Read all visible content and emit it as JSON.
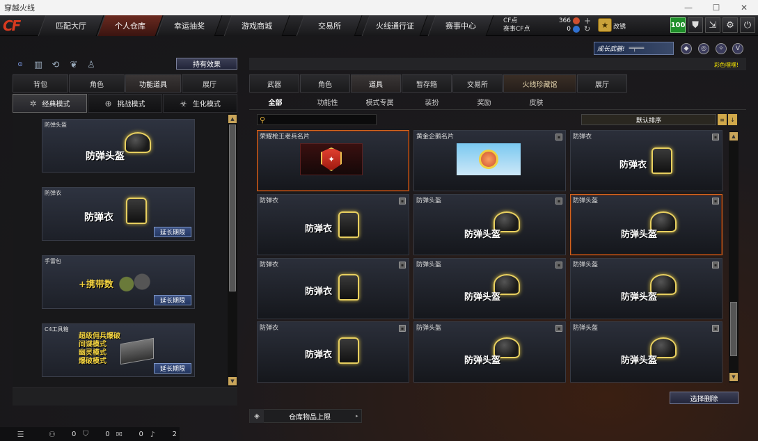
{
  "window": {
    "title": "穿越火线"
  },
  "nav": {
    "logo": "CF",
    "tabs": [
      {
        "label": "匹配大厅"
      },
      {
        "label": "个人仓库"
      },
      {
        "label": "幸运抽奖"
      },
      {
        "label": "游戏商城"
      },
      {
        "label": "交易所"
      },
      {
        "label": "火线通行证"
      },
      {
        "label": "赛事中心"
      }
    ],
    "active_tab": "个人仓库"
  },
  "points": {
    "cf_label": "CF点",
    "event_label": "赛事CF点",
    "cf_value": "366",
    "event_value": "0"
  },
  "user": {
    "rank_name": "改锈",
    "level": "100"
  },
  "banner": {
    "text": "成长武器!"
  },
  "yellow_note": "彩色嘿嘿!",
  "left": {
    "hold_effect_button": "持有效果",
    "tabs": [
      {
        "label": "背包"
      },
      {
        "label": "角色"
      },
      {
        "label": "功能道具"
      },
      {
        "label": "展厅"
      }
    ],
    "modes": [
      {
        "label": "经典模式"
      },
      {
        "label": "挑战模式"
      },
      {
        "label": "生化模式"
      }
    ],
    "items": [
      {
        "name": "防弹头盔",
        "big": "防弹头盔",
        "ext": ""
      },
      {
        "name": "防弹衣",
        "big": "防弹衣",
        "ext": "延长期限"
      },
      {
        "name": "手雷包",
        "big": "+携带数",
        "ext": "延长期限"
      },
      {
        "name": "C4工具箱",
        "lines": [
          "超级佣兵爆破",
          "间谍模式",
          "幽灵模式",
          "爆破模式"
        ],
        "ext": "延长期限"
      }
    ]
  },
  "right": {
    "tabs": [
      {
        "label": "武器"
      },
      {
        "label": "角色"
      },
      {
        "label": "道具"
      },
      {
        "label": "暂存箱"
      },
      {
        "label": "交易所"
      },
      {
        "label": "火线珍藏馆"
      },
      {
        "label": "展厅"
      }
    ],
    "subtabs": [
      {
        "label": "全部"
      },
      {
        "label": "功能性"
      },
      {
        "label": "模式专属"
      },
      {
        "label": "装扮"
      },
      {
        "label": "奖励"
      },
      {
        "label": "皮肤"
      }
    ],
    "search": {
      "placeholder": ""
    },
    "sort_label": "默认排序",
    "items": [
      {
        "name": "荣耀枪王老兵名片",
        "big": ""
      },
      {
        "name": "黄金企鹅名片",
        "big": ""
      },
      {
        "name": "防弹衣",
        "big": "防弹衣"
      },
      {
        "name": "防弹衣",
        "big": "防弹衣"
      },
      {
        "name": "防弹头盔",
        "big": "防弹头盔"
      },
      {
        "name": "防弹头盔",
        "big": "防弹头盔"
      },
      {
        "name": "防弹衣",
        "big": "防弹衣"
      },
      {
        "name": "防弹头盔",
        "big": "防弹头盔"
      },
      {
        "name": "防弹头盔",
        "big": "防弹头盔"
      },
      {
        "name": "防弹衣",
        "big": "防弹衣"
      },
      {
        "name": "防弹头盔",
        "big": "防弹头盔"
      },
      {
        "name": "防弹头盔",
        "big": "防弹头盔"
      }
    ],
    "delete_button": "选择删除",
    "capacity_label": "仓库物品上限"
  },
  "bottom": {
    "values": [
      "0",
      "0",
      "0",
      "2"
    ]
  }
}
